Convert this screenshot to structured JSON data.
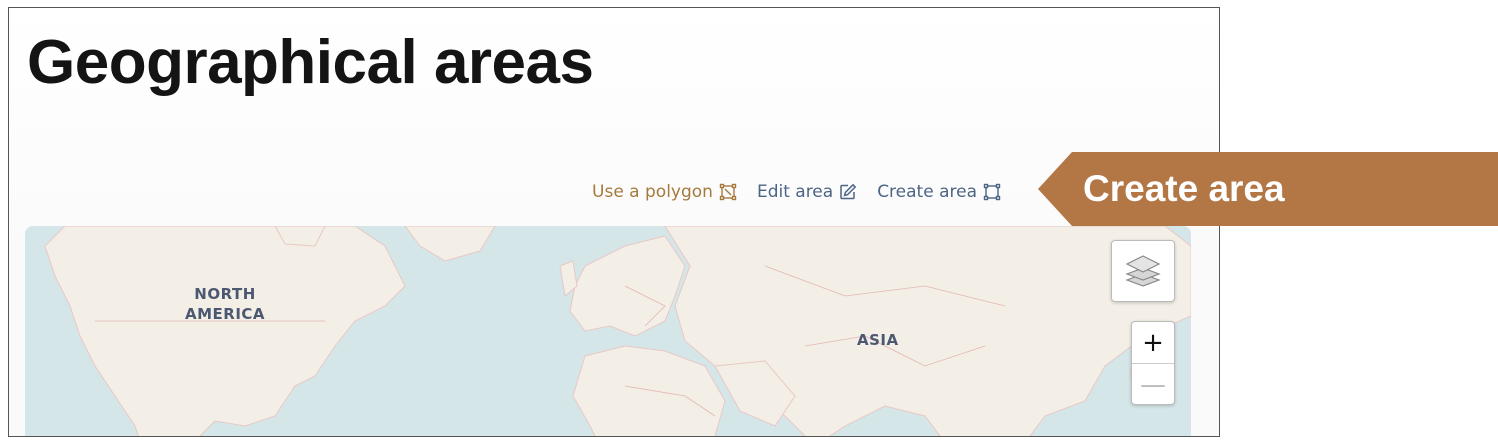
{
  "page": {
    "title": "Geographical areas"
  },
  "actions": {
    "use_polygon": "Use a polygon",
    "edit_area": "Edit area",
    "create_area": "Create area"
  },
  "map": {
    "labels": {
      "north_america": "NORTH\nAMERICA",
      "asia": "ASIA"
    },
    "zoom_in": "+",
    "zoom_out": "—"
  },
  "callout": {
    "text": "Create area"
  },
  "colors": {
    "accent": "#a57a3c",
    "link": "#4d6584",
    "callout": "#b37746",
    "water": "#d5e6e8",
    "land": "#f3efe6"
  }
}
